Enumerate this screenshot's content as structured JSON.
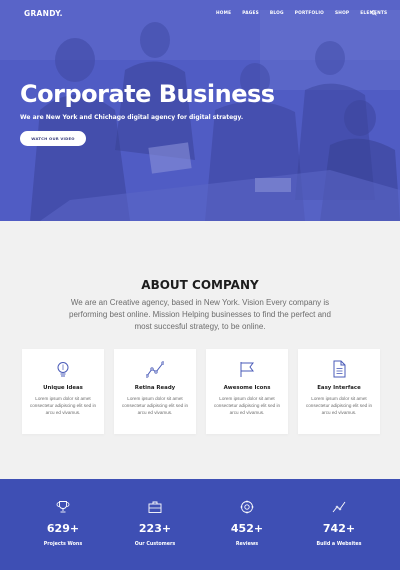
{
  "header": {
    "logo": "GRANDY.",
    "nav": [
      "HOME",
      "PAGES",
      "BLOG",
      "PORTFOLIO",
      "SHOP",
      "ELEMENTS"
    ]
  },
  "hero": {
    "title": "Corporate Business",
    "subtitle": "We are New York and Chichago digital agency for digital strategy.",
    "button_label": "WATCH OUR VIDEO"
  },
  "about": {
    "title": "ABOUT COMPANY",
    "text": "We are an Creative agency, based in New York. Vision Every company is performing best online. Mission Helping businesses to find the perfect and most succesful strategy, to be online."
  },
  "features": [
    {
      "icon": "lightbulb-icon",
      "title": "Unique Ideas",
      "text": "Lorem ipsum dolor sit amet consectetur adipiscing elit sed in arcu ed vivamus."
    },
    {
      "icon": "chart-line-icon",
      "title": "Retina Ready",
      "text": "Lorem ipsum dolor sit amet consectetur adipiscing elit sed in arcu ed vivamus."
    },
    {
      "icon": "flag-icon",
      "title": "Awesome Icons",
      "text": "Lorem ipsum dolor sit amet consectetur adipiscing elit sed in arcu ed vivamus."
    },
    {
      "icon": "document-icon",
      "title": "Easy Interface",
      "text": "Lorem ipsum dolor sit amet consectetur adipiscing elit sed in arcu ed vivamus."
    }
  ],
  "stats": [
    {
      "icon": "trophy-icon",
      "value": "629+",
      "label": "Projects Wons"
    },
    {
      "icon": "briefcase-icon",
      "value": "223+",
      "label": "Our Customers"
    },
    {
      "icon": "settings-icon",
      "value": "452+",
      "label": "Reviews"
    },
    {
      "icon": "chart-line-icon",
      "value": "742+",
      "label": "Build a Websites"
    }
  ],
  "colors": {
    "hero_blue": "#4e5ac2",
    "stats_blue": "#3e4fb4",
    "section_bg": "#f1f1f1",
    "icon_blue": "#4a5bb8"
  }
}
